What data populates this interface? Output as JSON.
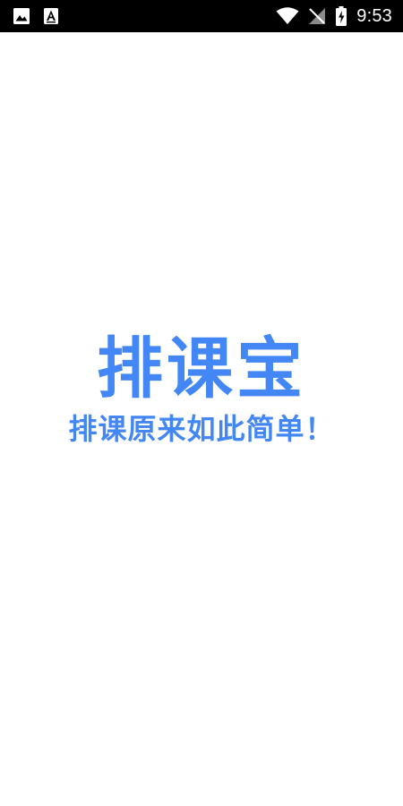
{
  "status_bar": {
    "time": "9:53",
    "left_icons": [
      "image-icon",
      "a-text-icon"
    ],
    "right_icons": [
      "wifi-icon",
      "no-signal-icon",
      "battery-charging-icon"
    ]
  },
  "splash": {
    "title": "排课宝",
    "slogan": "排课原来如此简单！"
  },
  "colors": {
    "accent": "#4287f5",
    "background": "#ffffff",
    "status_bar": "#000000"
  }
}
